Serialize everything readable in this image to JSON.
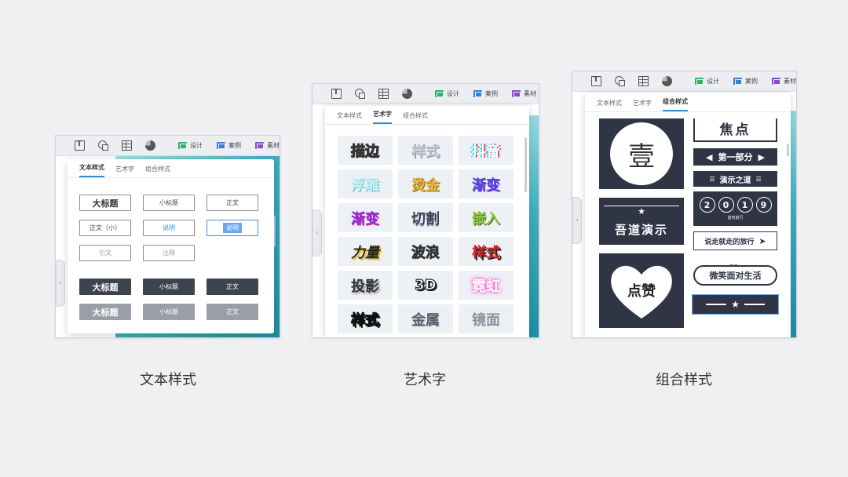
{
  "toolbar": {
    "design_label": "设计",
    "case_label": "案例",
    "material_label": "素材",
    "colors": {
      "design": "#2fb36a",
      "case": "#3a7bd5",
      "material": "#8c4cc9"
    }
  },
  "tabs": [
    "文本样式",
    "艺术字",
    "组合样式"
  ],
  "panel1": {
    "rows": [
      [
        "大标题",
        "小标题",
        "正文"
      ],
      [
        "正文（小）",
        "说明",
        "说明"
      ],
      [
        "引文",
        "注释"
      ],
      [
        "大标题",
        "小标题",
        "正文"
      ],
      [
        "大标题",
        "小标题",
        "正文"
      ]
    ]
  },
  "panel2": {
    "items": [
      "描边",
      "样式",
      "抖音",
      "浮雕",
      "烫金",
      "渐变",
      "渐变",
      "切割",
      "嵌入",
      "力量",
      "波浪",
      "样式",
      "投影",
      "3D",
      "霓虹",
      "样式",
      "金属",
      "镜面"
    ]
  },
  "panel3": {
    "circle_text": "壹",
    "heading_text": "焦点",
    "part_text": "第一部分",
    "speech_text": "演示之道",
    "year_digits": [
      "2",
      "0",
      "1",
      "9"
    ],
    "year_sub": "昔务前行",
    "brand_text": "吾道演示",
    "travel_text": "说走就走的旅行",
    "like_text": "点赞",
    "smile_text": "微笑面对生活"
  },
  "captions": [
    "文本样式",
    "艺术字",
    "组合样式"
  ]
}
